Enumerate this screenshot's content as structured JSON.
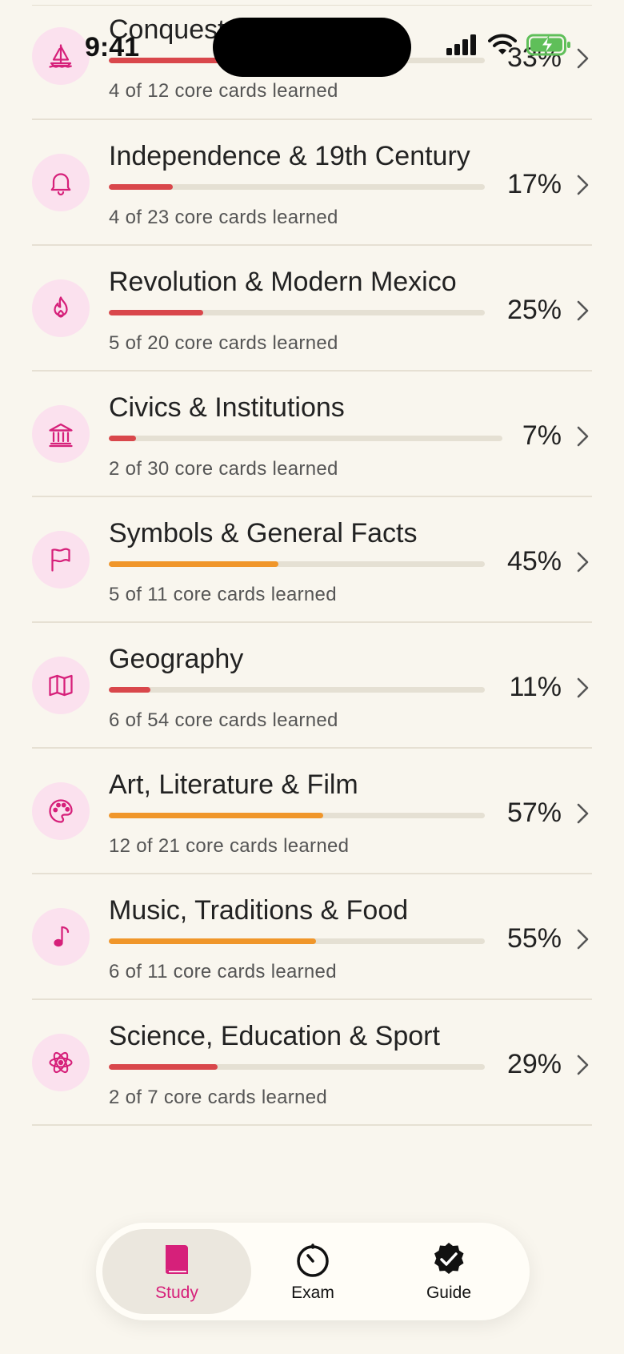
{
  "status_bar": {
    "time": "9:41"
  },
  "topics": [
    {
      "title": "Conquest",
      "progress_pct": 33,
      "percent_label": "33%",
      "subtitle": "4 of 12 core cards learned",
      "icon": "sailboat-icon",
      "bar_color": "#d9474b"
    },
    {
      "title": "Independence & 19th Century",
      "progress_pct": 17,
      "percent_label": "17%",
      "subtitle": "4 of 23 core cards learned",
      "icon": "bell-icon",
      "bar_color": "#d9474b"
    },
    {
      "title": "Revolution & Modern Mexico",
      "progress_pct": 25,
      "percent_label": "25%",
      "subtitle": "5 of 20 core cards learned",
      "icon": "flame-icon",
      "bar_color": "#d9474b"
    },
    {
      "title": "Civics & Institutions",
      "progress_pct": 7,
      "percent_label": "7%",
      "subtitle": "2 of 30 core cards learned",
      "icon": "landmark-icon",
      "bar_color": "#d9474b"
    },
    {
      "title": "Symbols & General Facts",
      "progress_pct": 45,
      "percent_label": "45%",
      "subtitle": "5 of 11 core cards learned",
      "icon": "flag-icon",
      "bar_color": "#f0962a"
    },
    {
      "title": "Geography",
      "progress_pct": 11,
      "percent_label": "11%",
      "subtitle": "6 of 54 core cards learned",
      "icon": "map-icon",
      "bar_color": "#d9474b"
    },
    {
      "title": "Art, Literature & Film",
      "progress_pct": 57,
      "percent_label": "57%",
      "subtitle": "12 of 21 core cards learned",
      "icon": "palette-icon",
      "bar_color": "#f0962a"
    },
    {
      "title": "Music, Traditions & Food",
      "progress_pct": 55,
      "percent_label": "55%",
      "subtitle": "6 of 11 core cards learned",
      "icon": "music-note-icon",
      "bar_color": "#f0962a"
    },
    {
      "title": "Science, Education & Sport",
      "progress_pct": 29,
      "percent_label": "29%",
      "subtitle": "2 of 7 core cards learned",
      "icon": "atom-icon",
      "bar_color": "#d9474b"
    }
  ],
  "tabs": [
    {
      "label": "Study",
      "icon": "book-icon",
      "active": true
    },
    {
      "label": "Exam",
      "icon": "stopwatch-icon",
      "active": false
    },
    {
      "label": "Guide",
      "icon": "badge-check-icon",
      "active": false
    }
  ],
  "colors": {
    "accent": "#d6207a",
    "icon_bg": "#fbe1ee",
    "bar_red": "#d9474b",
    "bar_orange": "#f0962a",
    "bar_track": "#e5e0d3",
    "background": "#f9f6ee"
  }
}
